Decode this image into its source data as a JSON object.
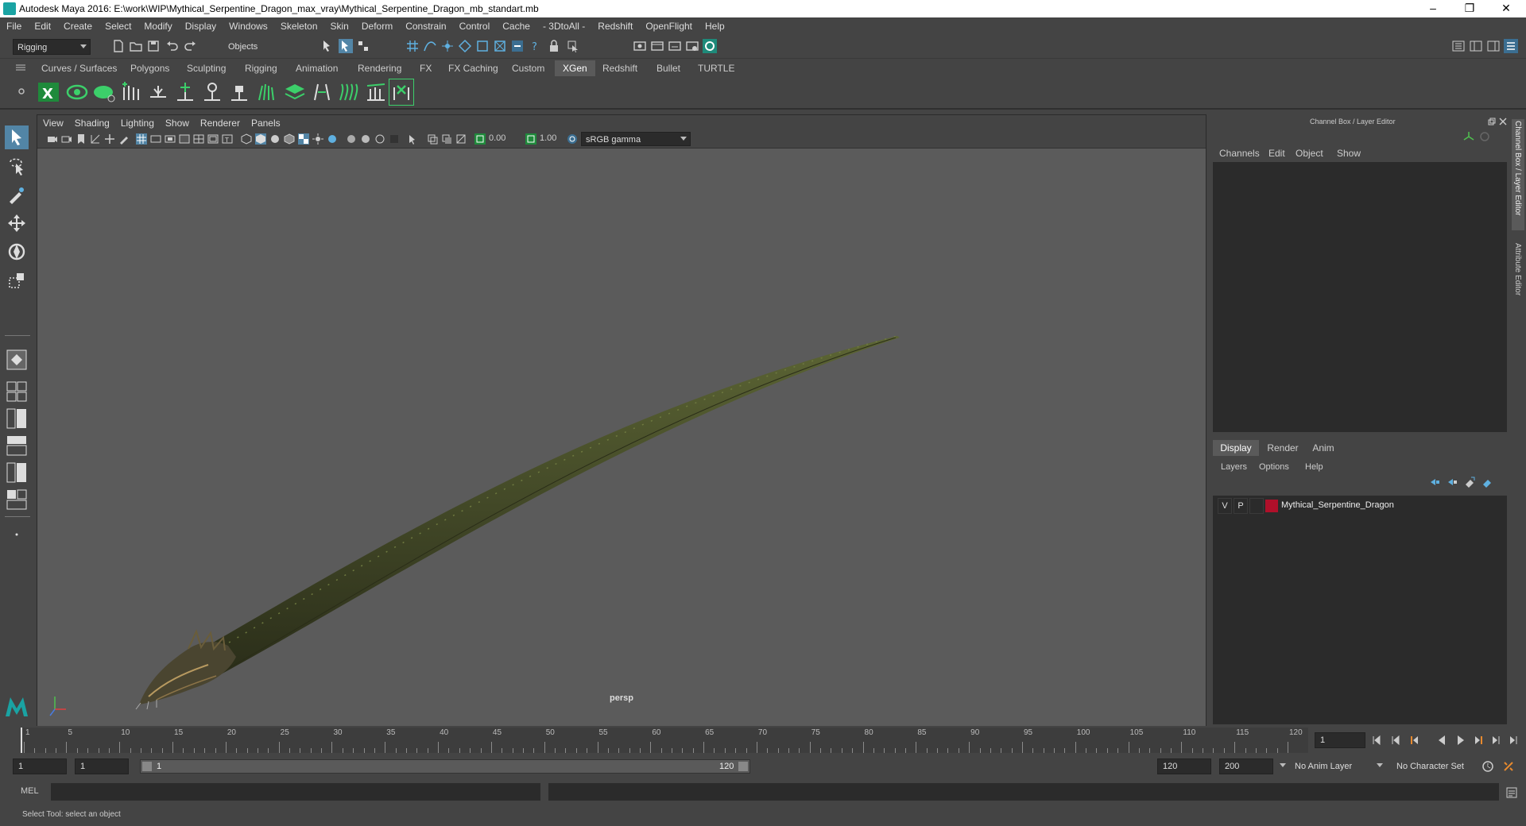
{
  "window": {
    "title": "Autodesk Maya 2016: E:\\work\\WIP\\Mythical_Serpentine_Dragon_max_vray\\Mythical_Serpentine_Dragon_mb_standart.mb",
    "minimize": "–",
    "restore": "❐",
    "close": "✕"
  },
  "menubar": [
    "File",
    "Edit",
    "Create",
    "Select",
    "Modify",
    "Display",
    "Windows",
    "Skeleton",
    "Skin",
    "Deform",
    "Constrain",
    "Control",
    "Cache",
    "- 3DtoAll -",
    "Redshift",
    "OpenFlight",
    "Help"
  ],
  "statusline": {
    "mode": "Rigging",
    "selection_mode": "Objects"
  },
  "shelf": {
    "tabs": [
      "Curves / Surfaces",
      "Polygons",
      "Sculpting",
      "Rigging",
      "Animation",
      "Rendering",
      "FX",
      "FX Caching",
      "Custom",
      "XGen",
      "Redshift",
      "Bullet",
      "TURTLE"
    ],
    "active_tab": "XGen"
  },
  "viewport": {
    "menu": [
      "View",
      "Shading",
      "Lighting",
      "Show",
      "Renderer",
      "Panels"
    ],
    "exposure": "0.00",
    "gamma": "1.00",
    "color_space": "sRGB gamma",
    "camera_label": "persp"
  },
  "channelbox": {
    "title": "Channel Box / Layer Editor",
    "menu": [
      "Channels",
      "Edit",
      "Object",
      "Show"
    ],
    "side_tabs": [
      "Channel Box / Layer Editor",
      "Attribute Editor"
    ]
  },
  "layer_editor": {
    "tabs": [
      "Display",
      "Render",
      "Anim"
    ],
    "active_tab": "Display",
    "menu": [
      "Layers",
      "Options",
      "Help"
    ],
    "layers": [
      {
        "visible": "V",
        "playback": "P",
        "color": "#b0102a",
        "name": "Mythical_Serpentine_Dragon"
      }
    ]
  },
  "timeline": {
    "ticks": [
      "1",
      "5",
      "10",
      "15",
      "20",
      "25",
      "30",
      "35",
      "40",
      "45",
      "50",
      "55",
      "60",
      "65",
      "70",
      "75",
      "80",
      "85",
      "90",
      "95",
      "100",
      "105",
      "110",
      "115",
      "120"
    ],
    "current_frame": "1"
  },
  "range": {
    "start": "1",
    "playback_start": "1",
    "slider_start": "1",
    "slider_end": "120",
    "playback_end": "120",
    "end": "200",
    "anim_layer": "No Anim Layer",
    "character_set": "No Character Set"
  },
  "commandline": {
    "label": "MEL"
  },
  "helpline": {
    "text": "Select Tool: select an object"
  }
}
